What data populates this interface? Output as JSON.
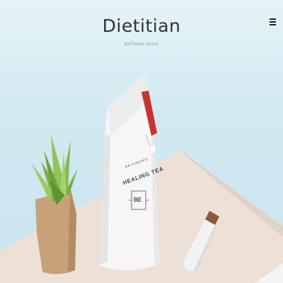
{
  "header": {
    "logo": "Dietitian",
    "tagline": "BeTheme layout",
    "menu_icon": "hamburger-menu-icon"
  },
  "scene": {
    "bag_label_line1": "DR FINCH'S",
    "bag_label_line2": "HEALING TEA",
    "bag_emblem": "BE"
  },
  "colors": {
    "sky": "#d2e9f1",
    "table": "#eadcd2",
    "pot": "#c7a27b",
    "succulent": "#8cc152",
    "bag": "#f7f7f7",
    "tag": "#c93333"
  }
}
